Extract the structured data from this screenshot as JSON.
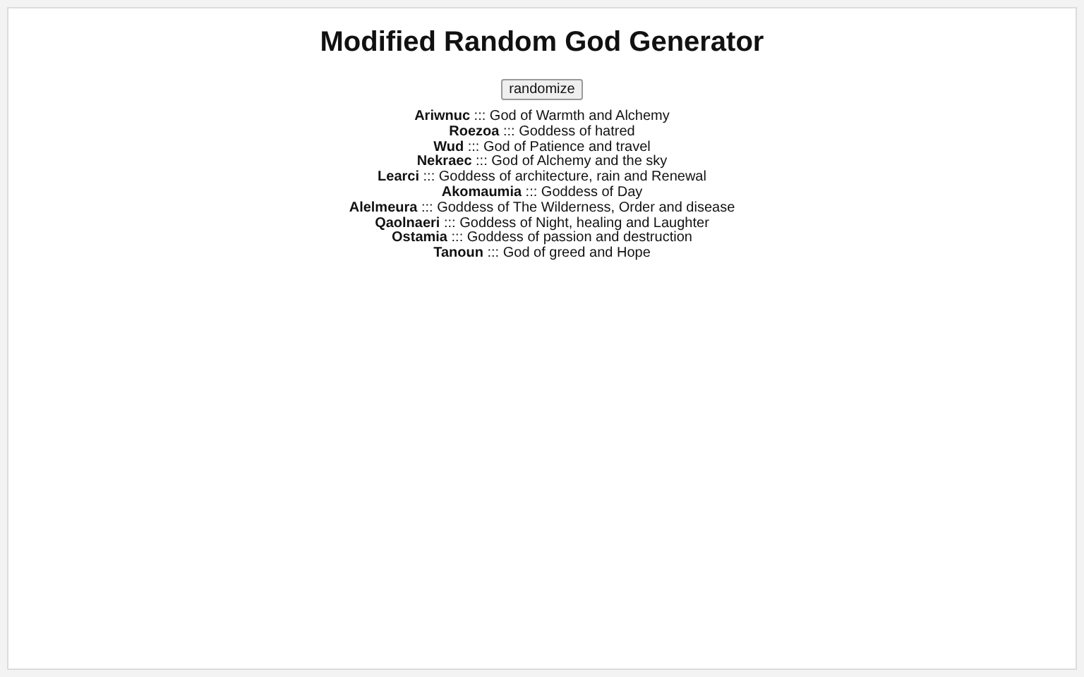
{
  "title": "Modified Random God Generator",
  "button": "randomize",
  "gods": [
    "**Ariwnuc** ::: God of Warmth and Alchemy",
    "**Roezoa** ::: Goddess of hatred",
    "**Wud** ::: God of Patience and travel",
    "**Nekraec** ::: God of Alchemy and the sky",
    "**Learci** ::: Goddess of architecture, rain and Renewal",
    "**Akomaumia** ::: Goddess of Day",
    "**Alelmeura** ::: Goddess of The Wilderness, Order and disease",
    "**Qaolnaeri** ::: Goddess of Night, healing and Laughter",
    "**Ostamia** ::: Goddess of passion and destruction",
    "**Tanoun** ::: God of greed and Hope"
  ]
}
